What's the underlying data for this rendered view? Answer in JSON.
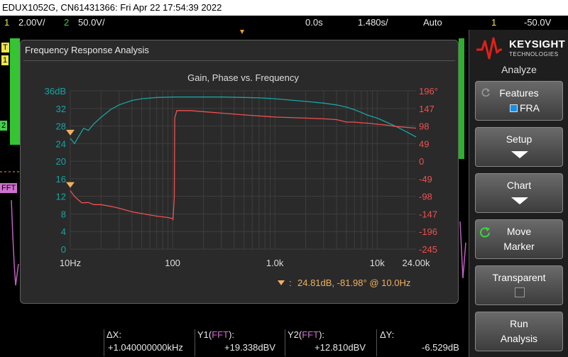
{
  "title_bar": "EDUX1052G, CN61431366: Fri Apr 22 17:54:39 2022",
  "status": {
    "ch1_num": "1",
    "ch1_scale": "2.00V/",
    "ch2_num": "2",
    "ch2_scale": "50.0V/",
    "time_offset": "0.0s",
    "time_scale": "1.480s/",
    "trigger_mode": "Auto",
    "trig_source": "1",
    "trig_level": "-50.0V"
  },
  "markers": {
    "t": "T",
    "ch1": "1",
    "ch2": "2",
    "fft": "FFT"
  },
  "panel": {
    "title": "Frequency Response Analysis"
  },
  "chart_data": {
    "type": "line",
    "title": "Gain, Phase vs. Frequency",
    "x_scale": "log",
    "xlim": [
      10,
      24000
    ],
    "x_tick_labels": [
      "10Hz",
      "100",
      "1.0k",
      "10k",
      "24.00k"
    ],
    "x_tick_values": [
      10,
      100,
      1000,
      10000,
      24000
    ],
    "y_left_ticks": [
      "36dB",
      "32",
      "28",
      "24",
      "20",
      "16",
      "12",
      "8",
      "4",
      "0"
    ],
    "ylim_left": [
      0,
      36
    ],
    "y_right_ticks": [
      "196°",
      "147",
      "98",
      "49",
      "0",
      "-49",
      "-98",
      "-147",
      "-196",
      "-245"
    ],
    "ylim_right": [
      -245,
      196
    ],
    "gain_color": "#1aa3a3",
    "phase_color": "#f05050",
    "series": [
      {
        "axis": "left",
        "x": [
          10,
          11,
          12,
          13.5,
          15,
          17,
          20,
          25,
          30,
          40,
          50,
          70,
          100,
          150,
          200,
          300,
          500,
          700,
          1000,
          2000,
          3000,
          4000,
          5000,
          6000,
          7000,
          8000,
          10000,
          12000,
          15000,
          20000,
          24000
        ],
        "y": [
          25.2,
          24,
          25.5,
          27.5,
          27,
          28.5,
          30,
          31.8,
          32.8,
          33.8,
          34.2,
          34.5,
          34.6,
          34.6,
          34.6,
          34.6,
          34.5,
          34.4,
          34.2,
          33.6,
          33.2,
          32.8,
          32.3,
          31.7,
          31.1,
          30.5,
          29.8,
          29,
          28,
          26.5,
          25.5
        ]
      },
      {
        "axis": "right",
        "x": [
          10,
          11,
          12,
          13,
          15,
          17,
          20,
          25,
          30,
          40,
          50,
          70,
          90,
          100,
          101,
          104,
          105,
          110,
          150,
          200,
          300,
          500,
          1000,
          2000,
          3000,
          4000,
          5000,
          6000,
          7000,
          8000,
          10000,
          12000,
          15000,
          20000,
          24000
        ],
        "y": [
          -82,
          -98,
          -108,
          -116,
          -115,
          -121,
          -121,
          -126,
          -131,
          -141,
          -146,
          -153,
          -157,
          -160,
          -162,
          -100,
          120,
          141,
          141,
          138,
          134,
          129,
          123,
          120,
          118,
          116,
          109,
          109,
          107,
          106,
          103,
          101,
          97,
          94,
          92
        ]
      }
    ],
    "marker_readout": "24.81dB, -81.98° @ 10.0Hz"
  },
  "sidebar": {
    "brand": "KEYSIGHT",
    "brand_sub": "TECHNOLOGIES",
    "menu_title": "Analyze",
    "softkeys": [
      {
        "line1": "Features",
        "line2": "FRA"
      },
      {
        "line1": "Setup"
      },
      {
        "line1": "Chart"
      },
      {
        "line1": "Move",
        "line2": "Marker"
      },
      {
        "line1": "Transparent"
      },
      {
        "line1": "Run",
        "line2": "Analysis"
      }
    ]
  },
  "measurements": {
    "dx_label": "ΔX:",
    "dx_value": "+1.040000000kHz",
    "y1_label": "Y1(",
    "y1_fft": "FFT",
    "y1_close": "):",
    "y1_value": "+19.338dBV",
    "y2_label": "Y2(",
    "y2_fft": "FFT",
    "y2_close": "):",
    "y2_value": "+12.810dBV",
    "dy_label": "ΔY:",
    "dy_value": "-6.529dB"
  }
}
